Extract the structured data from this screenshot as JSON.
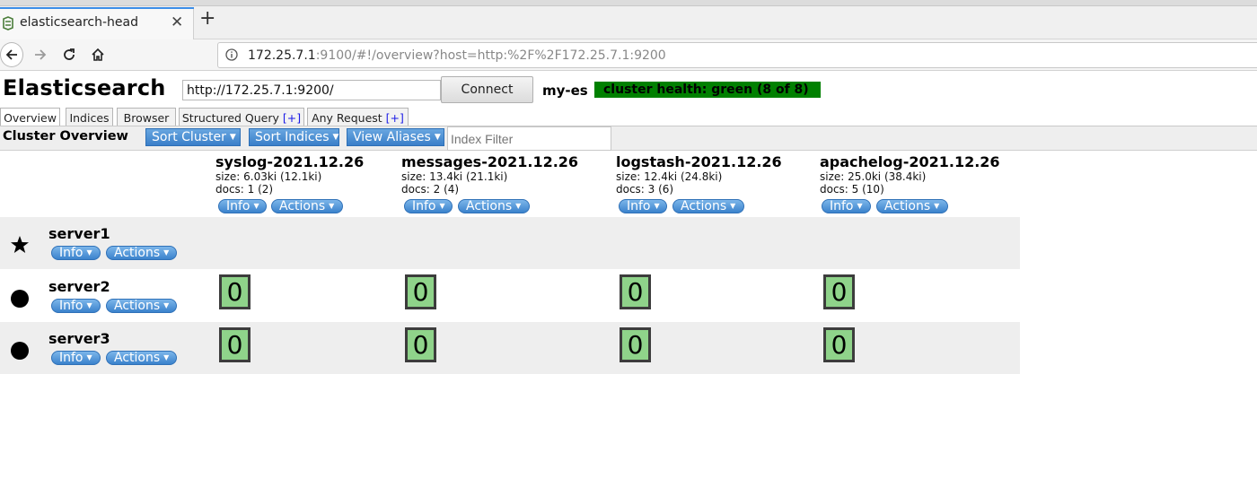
{
  "browser": {
    "tab_title": "elasticsearch-head",
    "new_tab_icon": "plus-icon",
    "url_host": "172.25.7.1",
    "url_rest": ":9100/#!/overview?host=http:%2F%2F172.25.7.1:9200"
  },
  "header": {
    "brand": "Elasticsearch",
    "connect_url": "http://172.25.7.1:9200/",
    "connect_label": "Connect",
    "cluster_name": "my-es",
    "health_text": "cluster health: green (8 of 8)",
    "health_color": "#008000"
  },
  "tabs": [
    {
      "label": "Overview",
      "plus": ""
    },
    {
      "label": "Indices",
      "plus": ""
    },
    {
      "label": "Browser",
      "plus": ""
    },
    {
      "label": "Structured Query ",
      "plus": "[+]"
    },
    {
      "label": "Any Request ",
      "plus": "[+]"
    }
  ],
  "toolbar": {
    "heading": "Cluster Overview",
    "sort_cluster": "Sort Cluster",
    "sort_indices": "Sort Indices",
    "view_aliases": "View Aliases",
    "filter_placeholder": "Index Filter"
  },
  "indices": [
    {
      "name": "syslog-2021.12.26",
      "size": "size: 6.03ki (12.1ki)",
      "docs": "docs: 1 (2)"
    },
    {
      "name": "messages-2021.12.26",
      "size": "size: 13.4ki (21.1ki)",
      "docs": "docs: 2 (4)"
    },
    {
      "name": "logstash-2021.12.26",
      "size": "size: 12.4ki (24.8ki)",
      "docs": "docs: 3 (6)"
    },
    {
      "name": "apachelog-2021.12.26",
      "size": "size: 25.0ki (38.4ki)",
      "docs": "docs: 5 (10)"
    }
  ],
  "buttons": {
    "info": "Info",
    "actions": "Actions"
  },
  "nodes": [
    {
      "name": "server1",
      "icon": "star-icon",
      "shards": []
    },
    {
      "name": "server2",
      "icon": "circle-icon",
      "shards": [
        "0",
        "0",
        "0",
        "0"
      ]
    },
    {
      "name": "server3",
      "icon": "circle-icon",
      "shards": [
        "0",
        "0",
        "0",
        "0"
      ]
    }
  ],
  "colors": {
    "shard_green": "#8fd38a",
    "button_blue": "#3a7fc9"
  }
}
